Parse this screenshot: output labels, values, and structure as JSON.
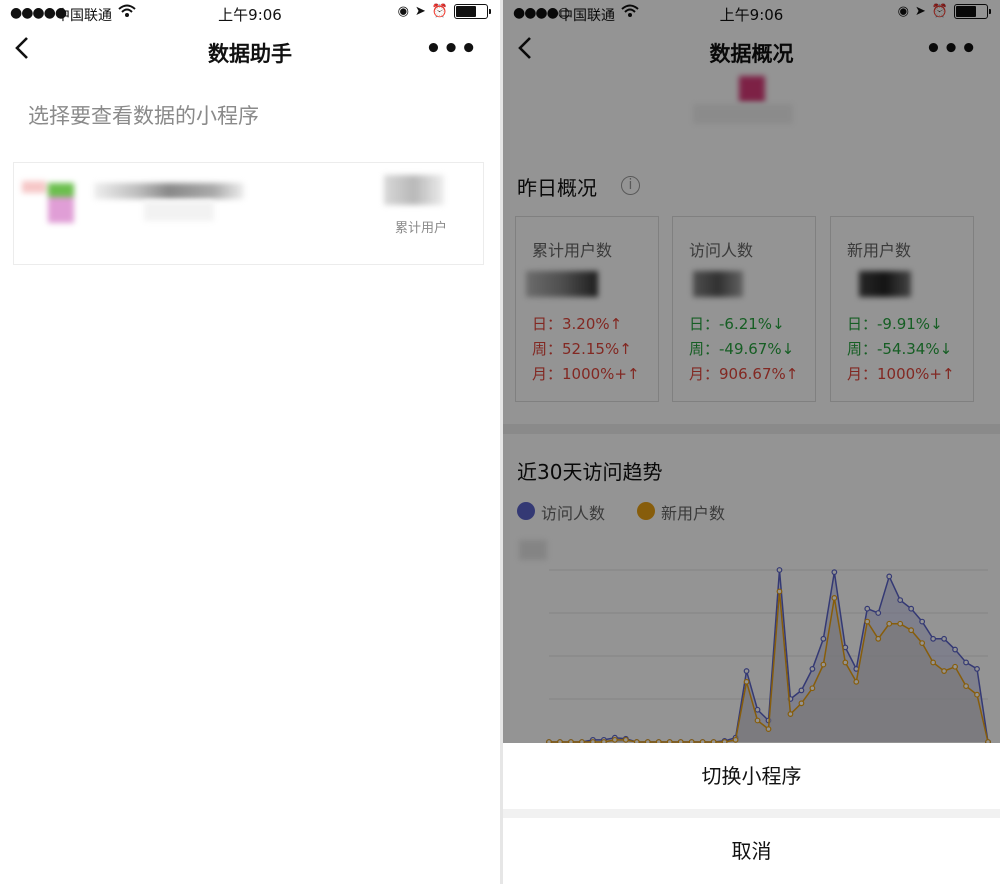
{
  "status_bar": {
    "signal": "●●●●●",
    "signal_right": "●●●●○",
    "carrier": "中国联通",
    "time": "上午9:06"
  },
  "left_screen": {
    "nav": {
      "back": "‹",
      "title": "数据助手",
      "more": "•••"
    },
    "subtitle": "选择要查看数据的小程序",
    "app_card": {
      "tag": "累计用户"
    }
  },
  "right_screen": {
    "nav": {
      "back": "‹",
      "title": "数据概况",
      "more": "•••"
    },
    "yesterday": {
      "title": "昨日概况",
      "info_icon": "i",
      "metrics": [
        {
          "label": "累计用户数",
          "lines": [
            {
              "text": "日：3.20%↑",
              "trend": "up"
            },
            {
              "text": "周：52.15%↑",
              "trend": "up"
            },
            {
              "text": "月：1000%+↑",
              "trend": "up"
            }
          ]
        },
        {
          "label": "访问人数",
          "lines": [
            {
              "text": "日：-6.21%↓",
              "trend": "down"
            },
            {
              "text": "周：-49.67%↓",
              "trend": "down"
            },
            {
              "text": "月：906.67%↑",
              "trend": "up"
            }
          ]
        },
        {
          "label": "新用户数",
          "lines": [
            {
              "text": "日：-9.91%↓",
              "trend": "down"
            },
            {
              "text": "周：-54.34%↓",
              "trend": "down"
            },
            {
              "text": "月：1000%+↑",
              "trend": "up"
            }
          ]
        }
      ]
    },
    "trend": {
      "title": "近30天访问趋势",
      "legend": [
        {
          "name": "访问人数",
          "color": "#5b63c8"
        },
        {
          "name": "新用户数",
          "color": "#e8a013"
        }
      ]
    },
    "action_sheet": {
      "switch": "切换小程序",
      "cancel": "取消"
    }
  },
  "chart_data": {
    "type": "area",
    "x": [
      1,
      2,
      3,
      4,
      5,
      6,
      7,
      8,
      9,
      10,
      11,
      12,
      13,
      14,
      15,
      16,
      17,
      18,
      19,
      20,
      21,
      22,
      23,
      24,
      25,
      26,
      27,
      28,
      29,
      30,
      31,
      32,
      33,
      34,
      35,
      36,
      37,
      38,
      39,
      40,
      41,
      42,
      43
    ],
    "series": [
      {
        "name": "访问人数",
        "color": "#5b63c8",
        "values": [
          0,
          0,
          0,
          0,
          1,
          1,
          2,
          1.5,
          0,
          0,
          0,
          0,
          0,
          0,
          0,
          0,
          0.5,
          2,
          33,
          15,
          10,
          80,
          20,
          24,
          34,
          48,
          79,
          44,
          34,
          62,
          60,
          77,
          66,
          62,
          56,
          48,
          48,
          43,
          37,
          34,
          0
        ]
      },
      {
        "name": "新用户数",
        "color": "#e8a013",
        "values": [
          0,
          0,
          0,
          0,
          0,
          0,
          1,
          1,
          0,
          0,
          0,
          0,
          0,
          0,
          0,
          0,
          0,
          1,
          28,
          10,
          6,
          70,
          13,
          18,
          25,
          36,
          67,
          37,
          28,
          56,
          48,
          55,
          55,
          52,
          46,
          37,
          33,
          35,
          26,
          22,
          0
        ]
      }
    ]
  }
}
